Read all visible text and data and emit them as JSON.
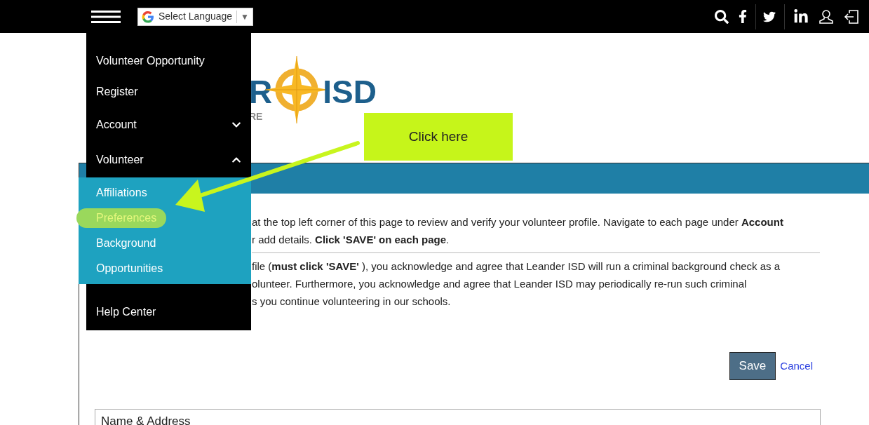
{
  "top_bar": {
    "language_select": {
      "label": "Select Language",
      "caret": "▼"
    }
  },
  "logo": {
    "text_start": "R",
    "text_end": "ISD",
    "tagline_fragment": "RE"
  },
  "menu": {
    "items": [
      {
        "label": "Volunteer Opportunity",
        "kind": "link"
      },
      {
        "label": "Register",
        "kind": "link"
      },
      {
        "label": "Account",
        "kind": "group",
        "expanded": false
      },
      {
        "label": "Volunteer",
        "kind": "group",
        "expanded": true,
        "children": [
          {
            "label": "Affiliations",
            "highlighted": false
          },
          {
            "label": "Preferences",
            "highlighted": true
          },
          {
            "label": "Background",
            "highlighted": false
          },
          {
            "label": "Opportunities",
            "highlighted": false
          }
        ]
      },
      {
        "label": "Help Center",
        "kind": "link"
      }
    ]
  },
  "callout": {
    "text": "Click here"
  },
  "panel": {
    "intro_lines": [
      "at the top left corner of this page to review and verify your volunteer profile. Navigate to each page under **Account**",
      "r add details. **Click 'SAVE' on each page**."
    ],
    "consent_lines": [
      "file (**must click 'SAVE'** ), you acknowledge and agree that Leander ISD will run a criminal background check as a",
      "olunteer. Furthermore, you acknowledge and agree that Leander ISD may periodically re-run such criminal",
      "s you continue volunteering in our schools."
    ],
    "save_button": "Save",
    "cancel_link": "Cancel",
    "section_title": "Name & Address"
  }
}
